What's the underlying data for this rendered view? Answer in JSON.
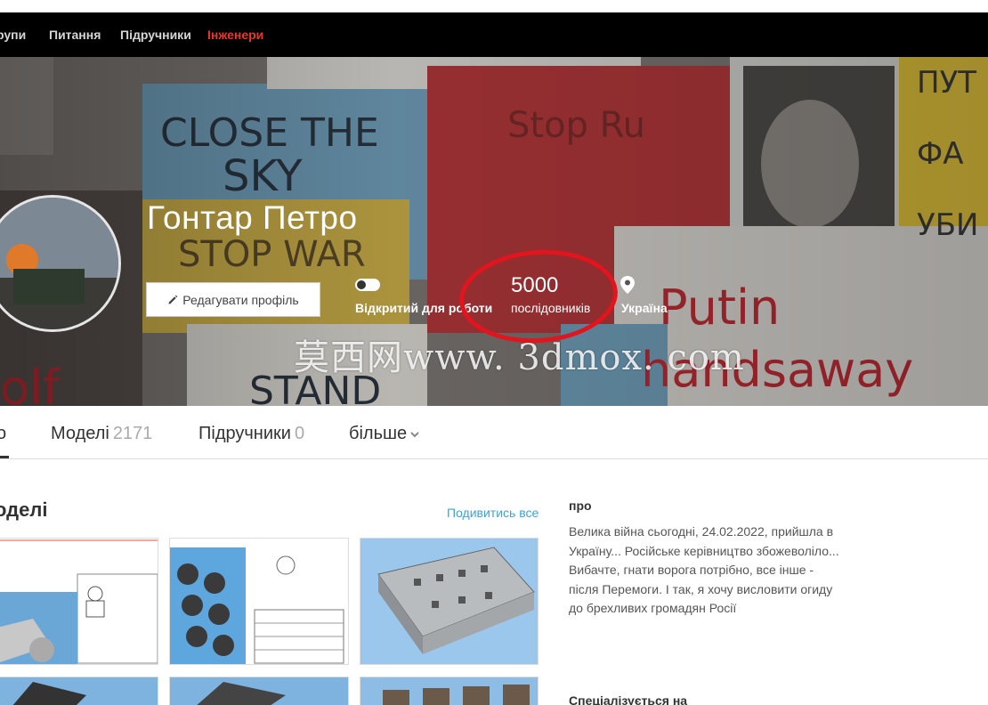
{
  "nav": {
    "items": [
      {
        "label": "рупи"
      },
      {
        "label": "Питання"
      },
      {
        "label": "Підручники"
      },
      {
        "label": "Інженери"
      }
    ]
  },
  "profile": {
    "name": "Гонтар Петро",
    "edit_label": "Редагувати профіль",
    "open_for_work": "Відкритий для роботи",
    "followers_count": "5000",
    "followers_label": "послідовників",
    "location": "Україна"
  },
  "watermark": "莫西网www. 3dmox. com",
  "tabs": {
    "first": "о",
    "models_label": "Моделі",
    "models_count": "2171",
    "tutorials_label": "Підручники",
    "tutorials_count": "0",
    "more_label": "більше"
  },
  "models_section": {
    "title": "оделі",
    "see_all": "Подивитись все"
  },
  "about": {
    "heading": "про",
    "text": "Велика війна сьогодні, 24.02.2022, прийшла в Україну... Російське керівництво збожеволіло... Вибачте, гнати ворога потрібно, все інше - після Перемоги. І так, я хочу висловити огиду до брехливих громадян Росії",
    "specializes_heading": "Спеціалізується на"
  },
  "colors": {
    "nav_bg": "#000000",
    "nav_active": "#e8382f",
    "link": "#3ba3d6",
    "annotation_circle": "#e3141e"
  }
}
